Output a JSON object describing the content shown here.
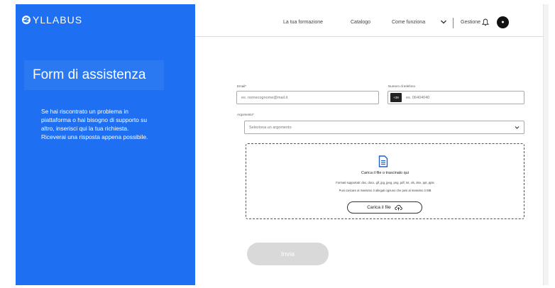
{
  "brand": {
    "name": "YLLABUS",
    "color": "#1e6ff1"
  },
  "sidebar": {
    "title": "Form di assistenza",
    "lines": [
      "Se hai riscontrato un problema in",
      "piattaforma o hai bisogno di supporto su",
      "altro, inserisci qui la tua richiesta.",
      "Riceverai una risposta appena possibile."
    ]
  },
  "nav": {
    "items": [
      "La tua formazione",
      "Catalogo",
      "Come funziona",
      "Gestione"
    ],
    "avatar_letter": "●",
    "icons": {
      "dropdown": "chevron-down-icon",
      "notifications": "bell-icon"
    }
  },
  "form": {
    "email": {
      "label": "Email*",
      "placeholder": "es. nomecognome@mail.it"
    },
    "phone": {
      "label": "Numero di telefono",
      "prefix": "+39",
      "placeholder": "es. 06404040"
    },
    "topic": {
      "label": "Argomento*",
      "value": "Seleziona un argomento"
    },
    "upload": {
      "title": "Carica il file o trascinalo qui",
      "formats": "Formati supportati: doc, docx, gif, jpg, jpeg, png, pdf, txt, xls, xlsx, ppt, pptx",
      "limits": "Puoi caricare al massimo 3 allegati ognuno che pesi al massimo 2 MB",
      "button": "Carica il file"
    },
    "submit": "Invia"
  }
}
